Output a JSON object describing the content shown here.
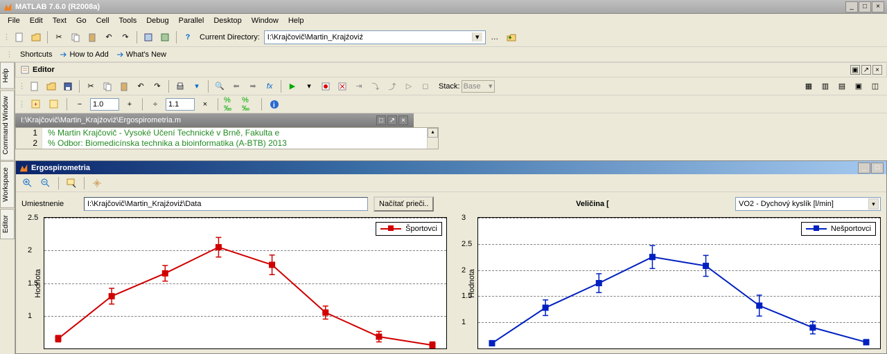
{
  "window": {
    "title": "MATLAB  7.6.0 (R2008a)"
  },
  "menu": [
    "File",
    "Edit",
    "Text",
    "Go",
    "Cell",
    "Tools",
    "Debug",
    "Parallel",
    "Desktop",
    "Window",
    "Help"
  ],
  "toolbar": {
    "dir_label": "Current Directory:",
    "dir_value": "I:\\Krajčovič\\Martin_Krajźoviź"
  },
  "shortcuts": {
    "label": "Shortcuts",
    "howto": "How to Add",
    "whatsnew": "What's New"
  },
  "sidetabs": [
    "Help",
    "Command Window",
    "Workspace",
    "Editor"
  ],
  "editor": {
    "title": "Editor",
    "cell_val1": "1.0",
    "cell_val2": "1.1",
    "stack_label": "Stack:",
    "stack_value": "Base",
    "tab_path": "I:\\Krajčovič\\Martin_Krajźoviź\\Ergospirometria.m",
    "line1_no": "1",
    "line2_no": "2",
    "line1": "% Martin Krajčovič - Vysoké Učení Technické v Brně, Fakulta e",
    "line2": "% Odbor: Biomedicínska technika a bioinformatika (A-BTB) 2013"
  },
  "figure": {
    "title": "Ergospirometria",
    "left": {
      "location_label": "Umiestnenie",
      "location_value": "I:\\Krajčovič\\Martin_Krajźoviź\\Data",
      "load_btn": "Načítať prieči..",
      "ylabel": "Hodnota",
      "legend": "Športovci"
    },
    "right": {
      "quantity_label": "Veličina [",
      "dropdown": "VO2 - Dychový kyslík [l/min]",
      "ylabel": "Hodnota",
      "legend": "Nešportovci"
    }
  },
  "chart_data": [
    {
      "type": "line",
      "title": "Športovci",
      "ylabel": "Hodnota",
      "ylim": [
        0.5,
        2.5
      ],
      "yticks": [
        1,
        1.5,
        2,
        2.5
      ],
      "color": "#d00000",
      "x": [
        1,
        2,
        3,
        4,
        5,
        6,
        7,
        8
      ],
      "y": [
        0.65,
        1.3,
        1.65,
        2.05,
        1.78,
        1.05,
        0.68,
        0.55
      ],
      "err": [
        0.05,
        0.12,
        0.12,
        0.15,
        0.15,
        0.1,
        0.08,
        0.05
      ]
    },
    {
      "type": "line",
      "title": "Nešportovci",
      "ylabel": "Hodnota",
      "ylim": [
        0.5,
        3.0
      ],
      "yticks": [
        1,
        1.5,
        2,
        2.5,
        3
      ],
      "color": "#0020c0",
      "x": [
        1,
        2,
        3,
        4,
        5,
        6,
        7,
        8
      ],
      "y": [
        0.6,
        1.28,
        1.75,
        2.25,
        2.08,
        1.32,
        0.9,
        0.62
      ],
      "err": [
        0.05,
        0.15,
        0.18,
        0.22,
        0.2,
        0.2,
        0.12,
        0.05
      ]
    }
  ]
}
